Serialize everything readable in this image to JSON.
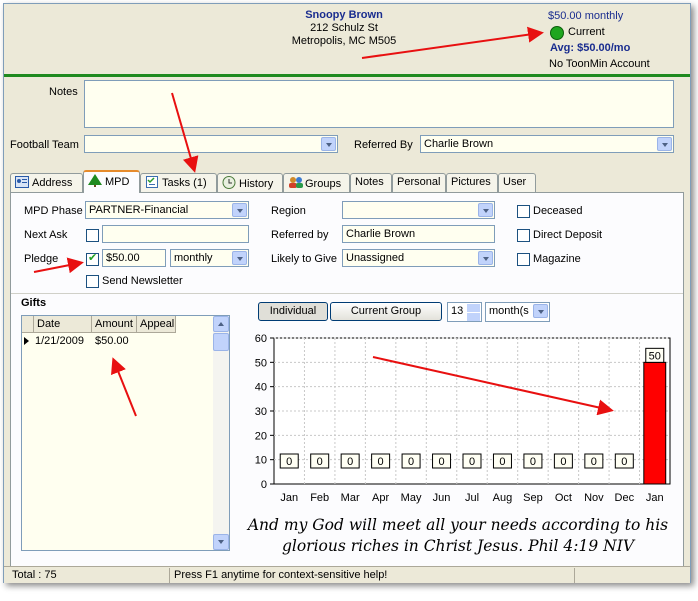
{
  "contact": {
    "name": "Snoopy Brown",
    "street": "212 Schulz St",
    "city_line": "Metropolis, MC  M505"
  },
  "summary": {
    "pledge": "$50.00 monthly",
    "status": "Current",
    "status_color": "#1fa61f",
    "avg": "Avg: $50.00/mo",
    "toonmin": "No ToonMin Account"
  },
  "top_form": {
    "notes_label": "Notes",
    "notes_value": "",
    "football_label": "Football Team",
    "football_value": "",
    "referred_label": "Referred By",
    "referred_value": "Charlie Brown"
  },
  "tabs": [
    {
      "label": "Address",
      "icon": "address-card-icon"
    },
    {
      "label": "MPD",
      "icon": "tree-icon"
    },
    {
      "label": "Tasks (1)",
      "icon": "task-list-icon"
    },
    {
      "label": "History",
      "icon": "history-icon"
    },
    {
      "label": "Groups",
      "icon": "group-icon"
    },
    {
      "label": "Notes"
    },
    {
      "label": "Personal"
    },
    {
      "label": "Pictures"
    },
    {
      "label": "User"
    }
  ],
  "mpd": {
    "phase_label": "MPD Phase",
    "phase_value": "PARTNER-Financial",
    "next_ask_label": "Next Ask",
    "next_ask_value": "",
    "pledge_label": "Pledge",
    "pledge_amount": "$50.00",
    "pledge_freq": "monthly",
    "send_newsletter": "Send Newsletter",
    "region_label": "Region",
    "region_value": "",
    "referred_by_label": "Referred by",
    "referred_by_value": "Charlie Brown",
    "likely_label": "Likely to Give",
    "likely_value": "Unassigned",
    "deceased": "Deceased",
    "direct_deposit": "Direct Deposit",
    "magazine": "Magazine"
  },
  "gifts": {
    "title": "Gifts",
    "columns": [
      "Date",
      "Amount",
      "Appeal"
    ],
    "rows": [
      {
        "date": "1/21/2009",
        "amount": "$50.00",
        "appeal": ""
      }
    ]
  },
  "chart_controls": {
    "individual": "Individual",
    "current_group": "Current Group",
    "months_value": "13",
    "unit": "month(s"
  },
  "chart_data": {
    "type": "bar",
    "categories": [
      "Jan",
      "Feb",
      "Mar",
      "Apr",
      "May",
      "Jun",
      "Jul",
      "Aug",
      "Sep",
      "Oct",
      "Nov",
      "Dec",
      "Jan"
    ],
    "values": [
      0,
      0,
      0,
      0,
      0,
      0,
      0,
      0,
      0,
      0,
      0,
      0,
      50
    ],
    "ylim": [
      0,
      60
    ],
    "yticks": [
      0,
      10,
      20,
      30,
      40,
      50,
      60
    ],
    "grid": true,
    "bar_color": "#ff0000"
  },
  "verse": "And my God will meet all your needs according to his glorious riches in Christ Jesus.  Phil 4:19 NIV",
  "status": {
    "total": "Total : 75",
    "help": "Press F1 anytime for context-sensitive help!"
  }
}
